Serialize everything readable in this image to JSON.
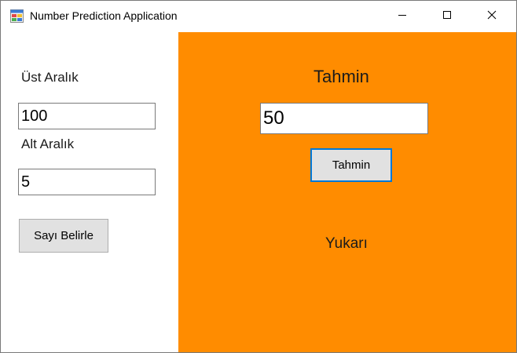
{
  "window": {
    "title": "Number Prediction Application",
    "panel_color": "#ff8c00",
    "icons": {
      "app": "app-window-icon",
      "minimize": "minimize-icon",
      "maximize": "maximize-icon",
      "close": "close-icon"
    }
  },
  "left": {
    "upper_label": "Üst Aralık",
    "upper_value": "100",
    "lower_label": "Alt Aralık",
    "lower_value": "5",
    "set_button": "Sayı Belirle"
  },
  "right": {
    "guess_label": "Tahmin",
    "guess_value": "50",
    "guess_button": "Tahmin",
    "result_text": "Yukarı"
  }
}
